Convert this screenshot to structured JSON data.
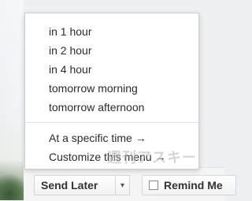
{
  "menu": {
    "items": [
      {
        "label": "in 1 hour"
      },
      {
        "label": "in 2 hour"
      },
      {
        "label": "in 4 hour"
      },
      {
        "label": "tomorrow morning"
      },
      {
        "label": "tomorrow afternoon"
      }
    ],
    "extra_items": [
      {
        "label": "At a specific time →"
      },
      {
        "label": "Customize this menu →"
      }
    ]
  },
  "toolbar": {
    "send_later_label": "Send Later",
    "dropdown_icon": "chevron-down-icon",
    "remind_label": "Remind Me"
  },
  "watermark": {
    "text": "週刊アスキー"
  }
}
